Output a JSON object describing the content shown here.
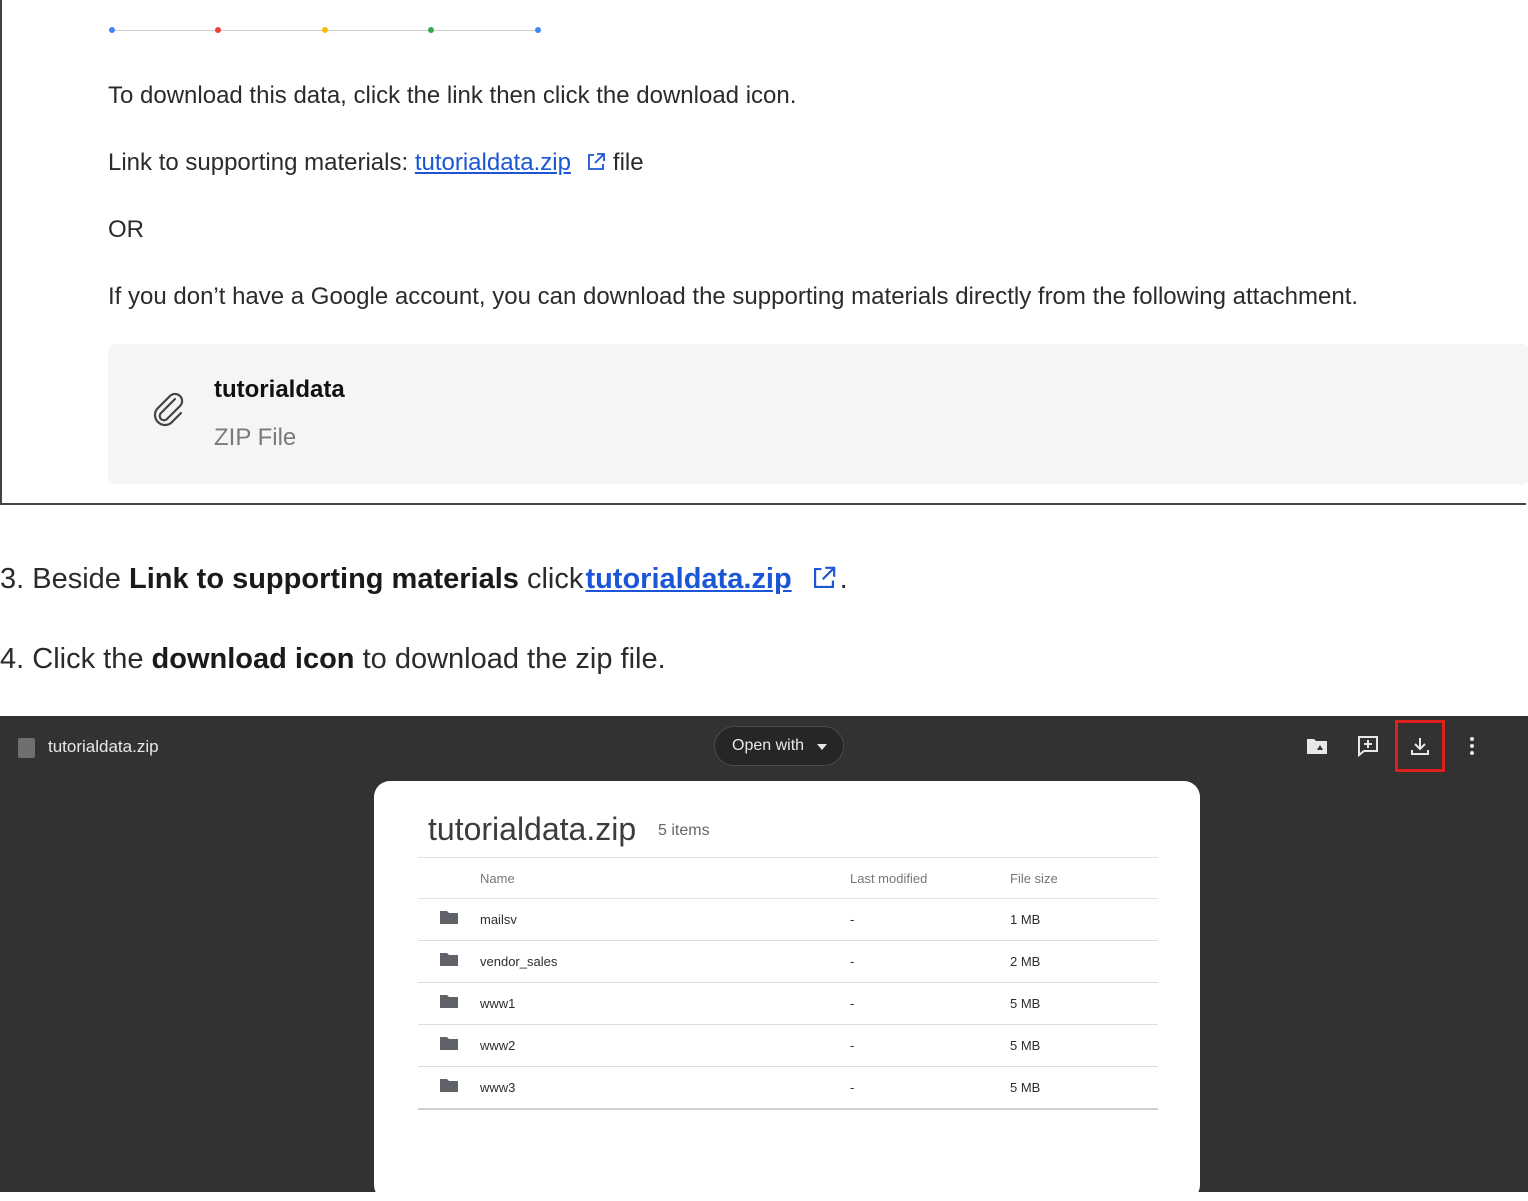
{
  "top_card": {
    "dot_colors": [
      "#4285f4",
      "#ea4335",
      "#fbbc05",
      "#34a853",
      "#4285f4"
    ],
    "instruction": "To download this data, click the link then click the download icon.",
    "link_prefix": "Link to supporting materials: ",
    "link_text": "tutorialdata.zip",
    "link_suffix": "file",
    "or_text": "OR",
    "no_account_text": "If you don’t have a Google account, you can download the supporting materials directly from the following attachment.",
    "attachment": {
      "icon": "paperclip-icon",
      "name": "tutorialdata",
      "type": "ZIP File"
    }
  },
  "steps": [
    {
      "number": "3. ",
      "pre": "Beside ",
      "bold": "Link to supporting materials",
      "mid": " click",
      "link": "tutorialdata.zip",
      "end": "."
    },
    {
      "number": "4. ",
      "pre": "Click the ",
      "bold": "download icon",
      "end": " to download the zip file."
    }
  ],
  "viewer": {
    "title": "tutorialdata.zip",
    "open_with": "Open with",
    "toolbar_icons": [
      "add-to-drive-icon",
      "add-comment-icon",
      "download-icon",
      "more-vert-icon"
    ],
    "highlight_color": "#e0201f",
    "panel": {
      "title": "tutorialdata.zip",
      "count": "5 items",
      "columns": [
        "Name",
        "Last modified",
        "File size"
      ],
      "rows": [
        {
          "name": "mailsv",
          "modified": "-",
          "size": "1 MB"
        },
        {
          "name": "vendor_sales",
          "modified": "-",
          "size": "2 MB"
        },
        {
          "name": "www1",
          "modified": "-",
          "size": "5 MB"
        },
        {
          "name": "www2",
          "modified": "-",
          "size": "5 MB"
        },
        {
          "name": "www3",
          "modified": "-",
          "size": "5 MB"
        }
      ]
    }
  }
}
